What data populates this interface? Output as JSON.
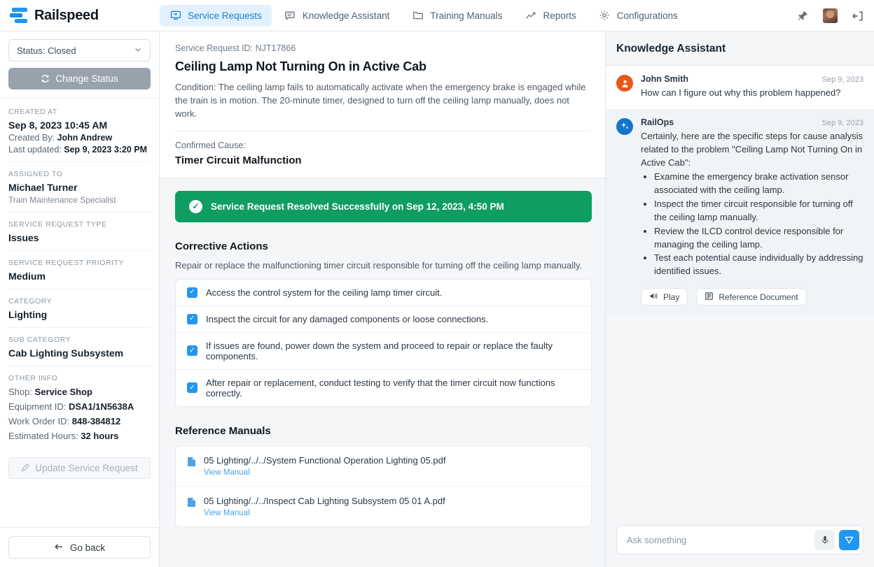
{
  "brand": {
    "name": "Railspeed",
    "logo_icon": "railspeed-logo-icon"
  },
  "nav": {
    "items": [
      {
        "label": "Service Requests",
        "icon": "monitor-icon",
        "active": true
      },
      {
        "label": "Knowledge Assistant",
        "icon": "chat-icon",
        "active": false
      },
      {
        "label": "Training Manuals",
        "icon": "folder-icon",
        "active": false
      },
      {
        "label": "Reports",
        "icon": "chart-line-icon",
        "active": false
      },
      {
        "label": "Configurations",
        "icon": "gear-icon",
        "active": false
      }
    ],
    "right_icons": [
      "pin-icon",
      "user-avatar",
      "logout-icon"
    ]
  },
  "sidebar": {
    "status_select": {
      "value": "Status: Closed",
      "chevron": "chevron-down-icon"
    },
    "change_status_button": {
      "label": "Change Status",
      "icon": "refresh-icon"
    },
    "created_at": {
      "label": "CREATED AT",
      "value": "Sep 8, 2023 10:45 AM",
      "created_by_label": "Created By:",
      "created_by": "John Andrew",
      "last_updated_label": "Last updated:",
      "last_updated": "Sep 9, 2023 3:20 PM"
    },
    "assigned_to": {
      "label": "ASSIGNED TO",
      "value": "Michael Turner",
      "role": "Train Maintenance Specialist"
    },
    "request_type": {
      "label": "SERVICE REQUEST TYPE",
      "value": "Issues"
    },
    "priority": {
      "label": "SERVICE REQUEST PRIORITY",
      "value": "Medium"
    },
    "category": {
      "label": "CATEGORY",
      "value": "Lighting"
    },
    "sub_category": {
      "label": "SUB CATEGORY",
      "value": "Cab Lighting Subsystem"
    },
    "other_info": {
      "label": "OTHER INFO",
      "shop_label": "Shop:",
      "shop": "Service Shop",
      "equipment_label": "Equipment ID:",
      "equipment": "DSA1/1N5638A",
      "work_order_label": "Work Order ID:",
      "work_order": "848-384812",
      "hours_label": "Estimated Hours:",
      "hours": "32 hours"
    },
    "update_button": {
      "label": "Update Service Request",
      "icon": "pencil-icon"
    },
    "go_back_button": {
      "label": "Go back",
      "icon": "arrow-left-icon"
    }
  },
  "main": {
    "request_id_label": "Service Request ID: NJT17866",
    "title": "Ceiling Lamp Not Turning On in Active Cab",
    "condition": "Condition: The ceiling lamp fails to automatically activate when the emergency brake is engaged while the train is in motion. The 20-minute timer, designed to turn off the ceiling lamp manually, does not work.",
    "confirmed_cause_label": "Confirmed Cause:",
    "confirmed_cause": "Timer Circuit Malfunction",
    "resolved_banner": {
      "text": "Service Request Resolved Successfully on Sep 12, 2023, 4:50 PM",
      "icon": "check-circle-icon",
      "color": "#0f9d62"
    },
    "corrective_actions": {
      "title": "Corrective Actions",
      "description": "Repair or replace the malfunctioning timer circuit responsible for turning off the ceiling lamp manually.",
      "tasks": [
        {
          "text": "Access the control system for the ceiling lamp timer circuit.",
          "checked": true
        },
        {
          "text": "Inspect the circuit for any damaged components or loose connections.",
          "checked": true
        },
        {
          "text": "If issues are found, power down the system and proceed to repair or replace the faulty components.",
          "checked": true
        },
        {
          "text": "After repair or replacement, conduct testing to verify that the timer circuit now functions correctly.",
          "checked": true
        }
      ]
    },
    "reference_manuals": {
      "title": "Reference Manuals",
      "items": [
        {
          "name": "05 Lighting/../../System Functional Operation Lighting 05.pdf",
          "link": "View Manual",
          "icon": "document-icon"
        },
        {
          "name": "05 Lighting/../../Inspect Cab Lighting Subsystem 05 01 A.pdf",
          "link": "View Manual",
          "icon": "document-icon"
        }
      ]
    }
  },
  "assistant": {
    "title": "Knowledge Assistant",
    "messages": [
      {
        "sender": "John Smith",
        "date": "Sep 9, 2023",
        "avatar_icon": "user-avatar-icon",
        "text": "How can I figure out why this problem happened?"
      },
      {
        "sender": "RailOps",
        "date": "Sep 9, 2023",
        "avatar_icon": "sparkle-icon",
        "text": "Certainly, here are the specific steps for cause analysis related to the problem \"Ceiling Lamp Not Turning On in Active Cab\":",
        "bullets": [
          "Examine the emergency brake activation sensor associated with the ceiling lamp.",
          "Inspect the timer circuit responsible for turning off the ceiling lamp manually.",
          "Review the ILCD control device responsible for managing the ceiling lamp.",
          "Test each potential cause individually by addressing identified issues."
        ],
        "actions": [
          {
            "label": "Play",
            "icon": "speaker-icon"
          },
          {
            "label": "Reference Document",
            "icon": "document-icon"
          }
        ]
      }
    ],
    "composer": {
      "placeholder": "Ask something",
      "value": "",
      "mic_icon": "microphone-icon",
      "send_icon": "send-icon"
    }
  }
}
